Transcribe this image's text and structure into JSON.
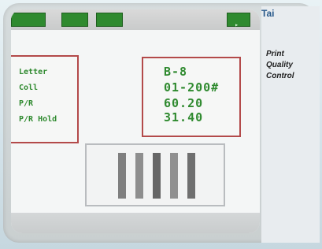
{
  "sidebar": {
    "logo_text": "Tai",
    "title_line_1": "Print",
    "title_line_2": "Quality",
    "title_line_3": "Control"
  },
  "panel_right": {
    "line1": "B-8",
    "line2": "01-200#",
    "line3": "60.20",
    "line4": "31.40"
  },
  "panel_left": {
    "items": [
      {
        "label": "Letter"
      },
      {
        "label": "Coll"
      },
      {
        "label": "P/R"
      },
      {
        "label": "P/R Hold"
      }
    ]
  },
  "colors": {
    "accent_green": "#2f8a2f",
    "border_red": "#b34a4a",
    "bezel": "#c9cfd0"
  },
  "icons": [
    "right-arrow-icon"
  ]
}
